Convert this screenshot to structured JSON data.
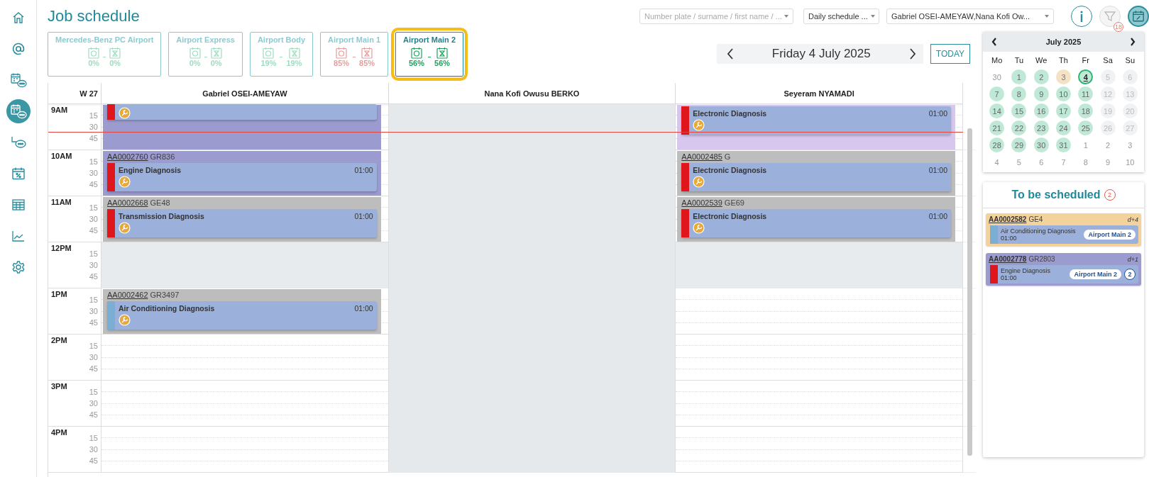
{
  "sidebar": {
    "items": [
      {
        "kind": "home",
        "selected": false
      },
      {
        "kind": "at",
        "selected": false
      },
      {
        "kind": "calendar-chat",
        "selected": false
      },
      {
        "kind": "calendar-chat",
        "selected": true
      },
      {
        "kind": "branch-chat",
        "selected": false
      },
      {
        "kind": "calendar-percent",
        "selected": false
      },
      {
        "kind": "table",
        "selected": false
      },
      {
        "kind": "chart",
        "selected": false
      },
      {
        "kind": "settings",
        "selected": false
      }
    ]
  },
  "header": {
    "title": "Job schedule",
    "search": {
      "placeholder": "Number plate / surname / first name / ..."
    },
    "view_select": {
      "value": "Daily schedule ..."
    },
    "resource_select": {
      "value": "Gabriel OSEI-AMEYAW,Nana Kofi Ow..."
    },
    "filter": {
      "badge": "18",
      "on": false
    },
    "capacity_view": {
      "on": true
    }
  },
  "sites": [
    {
      "name": "Mercedes-Benz PC Airport",
      "selected": false,
      "color": "#9fdcc0",
      "load": "0%",
      "waiting": "0%"
    },
    {
      "name": "Airport Express",
      "selected": false,
      "color": "#9fdcc0",
      "load": "0%",
      "waiting": "0%"
    },
    {
      "name": "Airport Body",
      "selected": false,
      "color": "#9fdcc0",
      "load": "19%",
      "waiting": "19%"
    },
    {
      "name": "Airport Main 1",
      "selected": false,
      "color": "#e89c9c",
      "load": "85%",
      "waiting": "85%"
    },
    {
      "name": "Airport Main 2",
      "selected": true,
      "color": "#1fa35c",
      "load": "56%",
      "waiting": "56%"
    }
  ],
  "date_nav": {
    "date": "Friday 4 July 2025",
    "today_button": "TODAY"
  },
  "schedule": {
    "week": "W 27",
    "resources": [
      "Gabriel OSEI-AMEYAW",
      "Nana Kofi Owusu BERKO",
      "Seyeram NYAMADI"
    ],
    "rows": [
      {
        "hour": "9AM",
        "marks": [
          "15",
          "30",
          "45"
        ],
        "cells": [
          {
            "kind": "job",
            "color": "#9b9bcf",
            "task": {
              "color": "#e0161d"
            }
          },
          {
            "kind": "off"
          },
          {
            "kind": "job",
            "color": "#d7c7ef",
            "task": {
              "name": "Electronic Diagnosis",
              "duration": "01:00",
              "color": "#e0161d"
            }
          }
        ]
      },
      {
        "hour": "10AM",
        "marks": [
          "15",
          "30",
          "45"
        ],
        "cells": [
          {
            "kind": "job",
            "color": "#9b9bcf",
            "job_number": "AA0002760",
            "plate": "GR836",
            "task": {
              "name": "Engine Diagnosis",
              "duration": "01:00",
              "color": "#e0161d"
            }
          },
          {
            "kind": "off"
          },
          {
            "kind": "job",
            "color": "#bdbdbd",
            "job_number": "AA0002485",
            "plate": "G",
            "task": {
              "name": "Electronic Diagnosis",
              "duration": "01:00",
              "color": "#e0161d"
            }
          }
        ]
      },
      {
        "hour": "11AM",
        "marks": [
          "15",
          "30",
          "45"
        ],
        "cells": [
          {
            "kind": "job",
            "color": "#bdbdbd",
            "job_number": "AA0002668",
            "plate": "GE48",
            "task": {
              "name": "Transmission Diagnosis",
              "duration": "01:00",
              "color": "#e0161d"
            }
          },
          {
            "kind": "off"
          },
          {
            "kind": "job",
            "color": "#bdbdbd",
            "job_number": "AA0002539",
            "plate": "GE69",
            "task": {
              "name": "Electronic Diagnosis",
              "duration": "01:00",
              "color": "#e0161d"
            }
          }
        ]
      },
      {
        "hour": "12PM",
        "marks": [
          "15",
          "30",
          "45"
        ],
        "cells": [
          {
            "kind": "break"
          },
          {
            "kind": "off"
          },
          {
            "kind": "break"
          }
        ]
      },
      {
        "hour": "1PM",
        "marks": [
          "15",
          "30",
          "45"
        ],
        "cells": [
          {
            "kind": "job",
            "color": "#bdbdbd",
            "job_number": "AA0002462",
            "plate": "GR3497",
            "task": {
              "name": "Air Conditioning Diagnosis",
              "duration": "01:00",
              "color": "#7aaed3"
            }
          },
          {
            "kind": "off"
          },
          {
            "kind": "free"
          }
        ]
      },
      {
        "hour": "2PM",
        "marks": [
          "15",
          "30",
          "45"
        ],
        "cells": [
          {
            "kind": "free"
          },
          {
            "kind": "off"
          },
          {
            "kind": "free"
          }
        ]
      },
      {
        "hour": "3PM",
        "marks": [
          "15",
          "30",
          "45"
        ],
        "cells": [
          {
            "kind": "free"
          },
          {
            "kind": "off"
          },
          {
            "kind": "free"
          }
        ]
      },
      {
        "hour": "4PM",
        "marks": [
          "15",
          "30",
          "45"
        ],
        "cells": [
          {
            "kind": "free"
          },
          {
            "kind": "off"
          },
          {
            "kind": "free"
          }
        ]
      }
    ]
  },
  "mini_calendar": {
    "month": "July 2025",
    "weekdays": [
      "Mo",
      "Tu",
      "We",
      "Th",
      "Fr",
      "Sa",
      "Su"
    ],
    "days": [
      {
        "day": "30",
        "kind": "outside"
      },
      {
        "day": "1",
        "kind": "open"
      },
      {
        "day": "2",
        "kind": "open"
      },
      {
        "day": "3",
        "kind": "partial"
      },
      {
        "day": "4",
        "kind": "today"
      },
      {
        "day": "5",
        "kind": "closed"
      },
      {
        "day": "6",
        "kind": "closed"
      },
      {
        "day": "7",
        "kind": "open"
      },
      {
        "day": "8",
        "kind": "open"
      },
      {
        "day": "9",
        "kind": "open"
      },
      {
        "day": "10",
        "kind": "open"
      },
      {
        "day": "11",
        "kind": "open"
      },
      {
        "day": "12",
        "kind": "closed"
      },
      {
        "day": "13",
        "kind": "closed"
      },
      {
        "day": "14",
        "kind": "open"
      },
      {
        "day": "15",
        "kind": "open"
      },
      {
        "day": "16",
        "kind": "open"
      },
      {
        "day": "17",
        "kind": "open"
      },
      {
        "day": "18",
        "kind": "open"
      },
      {
        "day": "19",
        "kind": "closed"
      },
      {
        "day": "20",
        "kind": "closed"
      },
      {
        "day": "21",
        "kind": "open"
      },
      {
        "day": "22",
        "kind": "open"
      },
      {
        "day": "23",
        "kind": "open"
      },
      {
        "day": "24",
        "kind": "open"
      },
      {
        "day": "25",
        "kind": "open"
      },
      {
        "day": "26",
        "kind": "closed"
      },
      {
        "day": "27",
        "kind": "closed"
      },
      {
        "day": "28",
        "kind": "open"
      },
      {
        "day": "29",
        "kind": "open"
      },
      {
        "day": "30",
        "kind": "open"
      },
      {
        "day": "31",
        "kind": "open"
      },
      {
        "day": "1",
        "kind": "outside"
      },
      {
        "day": "2",
        "kind": "outside"
      },
      {
        "day": "3",
        "kind": "outside"
      },
      {
        "day": "4",
        "kind": "outside"
      },
      {
        "day": "5",
        "kind": "outside"
      },
      {
        "day": "6",
        "kind": "outside"
      },
      {
        "day": "7",
        "kind": "outside"
      },
      {
        "day": "8",
        "kind": "outside"
      },
      {
        "day": "9",
        "kind": "outside"
      },
      {
        "day": "10",
        "kind": "outside"
      }
    ]
  },
  "to_be_scheduled": {
    "title": "To be scheduled",
    "count": "2",
    "items": [
      {
        "job_number": "AA0002582",
        "plate": "GE4",
        "due": "d+4",
        "color": "#f3d29c",
        "task": {
          "name": "Air Conditioning Diagnosis",
          "duration": "01:00",
          "color": "#7aaed3"
        },
        "site": "Airport Main 2"
      },
      {
        "job_number": "AA0002778",
        "plate": "GR2803",
        "due": "d+1",
        "color": "#9b9bcf",
        "task": {
          "name": "Engine Diagnosis",
          "duration": "01:00",
          "color": "#e0161d"
        },
        "site": "Airport Main 2",
        "badge": "2"
      }
    ]
  }
}
